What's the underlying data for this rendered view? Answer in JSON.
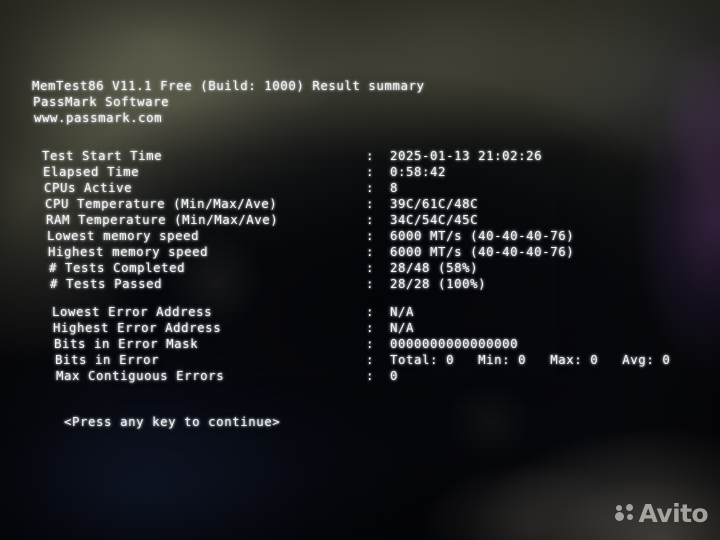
{
  "app": {
    "name": "MemTest86",
    "header_lines": [
      "MemTest86 V11.1 Free (Build: 1000) Result summary",
      "PassMark Software",
      "www.passmark.com"
    ]
  },
  "summary": {
    "separator": ":",
    "rows": [
      {
        "label": "Test Start Time",
        "value": "2025-01-13 21:02:26"
      },
      {
        "label": "Elapsed Time",
        "value": "0:58:42"
      },
      {
        "label": "CPUs Active",
        "value": "8"
      },
      {
        "label": "CPU Temperature (Min/Max/Ave)",
        "value": "39C/61C/48C"
      },
      {
        "label": "RAM Temperature (Min/Max/Ave)",
        "value": "34C/54C/45C"
      },
      {
        "label": "Lowest memory speed",
        "value": "6000 MT/s (40-40-40-76)"
      },
      {
        "label": "Highest memory speed",
        "value": "6000 MT/s (40-40-40-76)"
      },
      {
        "label": "# Tests Completed",
        "value": "28/48 (58%)"
      },
      {
        "label": "# Tests Passed",
        "value": "28/28 (100%)"
      }
    ]
  },
  "errors": {
    "separator": ":",
    "rows": [
      {
        "label": "Lowest Error Address",
        "value": "N/A"
      },
      {
        "label": "Highest Error Address",
        "value": "N/A"
      },
      {
        "label": "Bits in Error Mask",
        "value": "0000000000000000"
      },
      {
        "label": "Bits in Error",
        "value": "Total: 0   Min: 0   Max: 0   Avg: 0"
      },
      {
        "label": "Max Contiguous Errors",
        "value": "0"
      }
    ]
  },
  "footer": {
    "prompt": "<Press any key to continue>"
  },
  "watermark": {
    "text": "Avito",
    "logo": "avito-dots-icon"
  },
  "colors": {
    "text": "#f2f4f2",
    "screen_dark": "#05060a",
    "screen_olive": "#4a4a3c",
    "glare_purple": "#965cb0",
    "watermark": "#dedbd4"
  }
}
